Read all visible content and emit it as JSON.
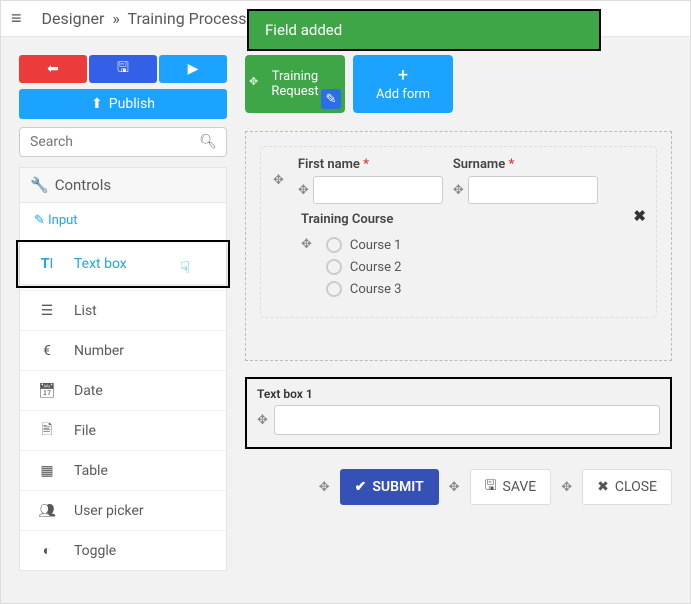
{
  "breadcrumb": {
    "root": "Designer",
    "page": "Training Process"
  },
  "toast": "Field added",
  "sidebar": {
    "publish": "Publish",
    "search_placeholder": "Search",
    "controls_header": "Controls",
    "input_sub": "Input",
    "items": [
      {
        "label": "Text box"
      },
      {
        "label": "List"
      },
      {
        "label": "Number"
      },
      {
        "label": "Date"
      },
      {
        "label": "File"
      },
      {
        "label": "Table"
      },
      {
        "label": "User picker"
      },
      {
        "label": "Toggle"
      }
    ]
  },
  "tabs": {
    "active": "Training Request",
    "add": "Add form"
  },
  "form": {
    "first_name_label": "First name",
    "surname_label": "Surname",
    "course_label": "Training Course",
    "courses": [
      "Course 1",
      "Course 2",
      "Course 3"
    ],
    "textbox_label": "Text box 1"
  },
  "actions": {
    "submit": "SUBMIT",
    "save": "SAVE",
    "close": "CLOSE"
  }
}
